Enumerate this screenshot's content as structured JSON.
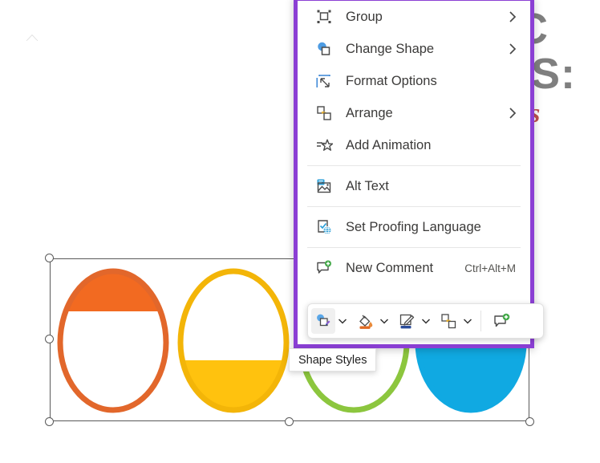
{
  "app": "powerpoint-shape-context-menu",
  "slide": {
    "background_text": {
      "line1": "IC",
      "line2": "TS:",
      "line3": "pes",
      "heading_color": "#7f7f7f",
      "accent_color": "#c0504d"
    },
    "selection": {
      "handles": 8,
      "frame_color": "#595959"
    },
    "shapes": [
      {
        "name": "egg-orange",
        "fill": "#F26A21",
        "stroke": "#E2672B",
        "fill_level_pct": 30,
        "fill_from": "top"
      },
      {
        "name": "egg-yellow",
        "fill": "#FFC20E",
        "stroke": "#F3B508",
        "fill_level_pct": 45,
        "fill_from": "bottom"
      },
      {
        "name": "egg-green",
        "fill": "#FFFFFF",
        "stroke": "#8CC63E",
        "fill_level_pct": 0,
        "fill_from": "bottom"
      },
      {
        "name": "egg-blue",
        "fill": "#10A9E2",
        "stroke": "#10A9E2",
        "fill_level_pct": 55,
        "fill_from": "bottom"
      }
    ]
  },
  "context_menu": {
    "border_color": "#8b3fd4",
    "items": [
      {
        "label": "Group",
        "icon": "group-icon",
        "submenu": true,
        "shortcut": ""
      },
      {
        "label": "Change Shape",
        "icon": "change-shape-icon",
        "submenu": true,
        "shortcut": ""
      },
      {
        "label": "Format Options",
        "icon": "format-options-icon",
        "submenu": false,
        "shortcut": ""
      },
      {
        "label": "Arrange",
        "icon": "arrange-icon",
        "submenu": true,
        "shortcut": ""
      },
      {
        "label": "Add Animation",
        "icon": "add-animation-icon",
        "submenu": false,
        "shortcut": ""
      },
      {
        "label": "Alt Text",
        "icon": "alt-text-icon",
        "submenu": false,
        "shortcut": ""
      },
      {
        "label": "Set Proofing Language",
        "icon": "proofing-language-icon",
        "submenu": false,
        "shortcut": ""
      },
      {
        "label": "New Comment",
        "icon": "new-comment-icon",
        "submenu": false,
        "shortcut": "Ctrl+Alt+M"
      }
    ],
    "separators_after": [
      4,
      5,
      6
    ]
  },
  "mini_toolbar": {
    "buttons": [
      {
        "name": "shape-styles-button",
        "icon": "shape-styles-icon",
        "caret": true,
        "active": true
      },
      {
        "name": "fill-color-button",
        "icon": "fill-bucket-icon",
        "caret": true,
        "active": false
      },
      {
        "name": "shape-outline-button",
        "icon": "pen-outline-icon",
        "caret": true,
        "active": false
      },
      {
        "name": "arrange-button",
        "icon": "arrange-icon",
        "caret": true,
        "active": false
      },
      {
        "name": "new-comment-button",
        "icon": "new-comment-icon",
        "caret": false,
        "active": false
      }
    ]
  },
  "tooltip": {
    "text": "Shape Styles"
  }
}
